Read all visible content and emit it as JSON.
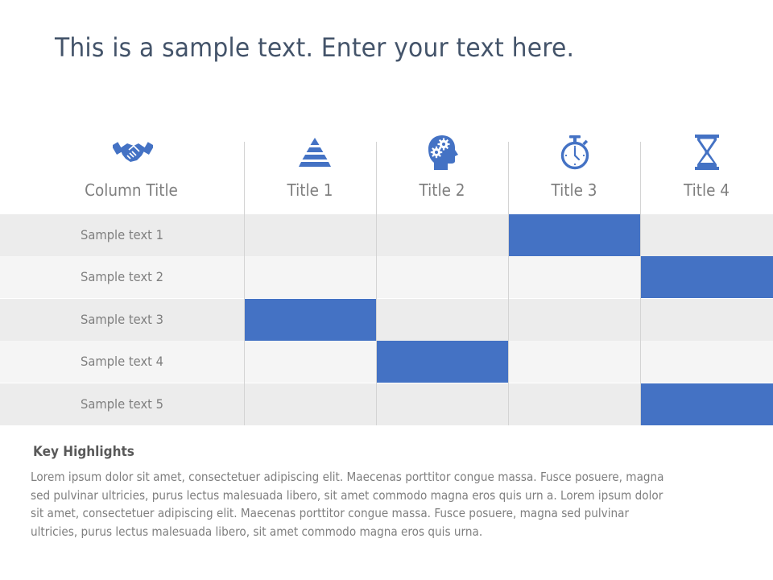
{
  "slide": {
    "title": "This is a sample text. Enter your text here."
  },
  "table": {
    "accent_color": "#4472c4",
    "columns": [
      {
        "label": "Column Title",
        "icon": "handshake-icon"
      },
      {
        "label": "Title 1",
        "icon": "pyramid-icon"
      },
      {
        "label": "Title 2",
        "icon": "head-gears-icon"
      },
      {
        "label": "Title 3",
        "icon": "stopwatch-icon"
      },
      {
        "label": "Title 4",
        "icon": "hourglass-icon"
      }
    ],
    "rows": [
      {
        "label": "Sample text 1",
        "highlighted_column": 3
      },
      {
        "label": "Sample text 2",
        "highlighted_column": 4
      },
      {
        "label": "Sample text 3",
        "highlighted_column": 1
      },
      {
        "label": "Sample text 4",
        "highlighted_column": 2
      },
      {
        "label": "Sample text 5",
        "highlighted_column": 4
      }
    ]
  },
  "highlights": {
    "title": "Key Highlights",
    "lines": [
      "Lorem ipsum dolor sit amet, consectetuer adipiscing elit. Maecenas porttitor congue massa. Fusce posuere, magna",
      "sed pulvinar ultricies, purus lectus malesuada libero, sit amet commodo magna eros quis urn a. Lorem ipsum dolor",
      "sit amet, consectetuer adipiscing elit. Maecenas porttitor congue massa. Fusce posuere, magna sed pulvinar",
      "ultricies, purus lectus malesuada libero, sit amet commodo magna eros quis urna."
    ]
  }
}
